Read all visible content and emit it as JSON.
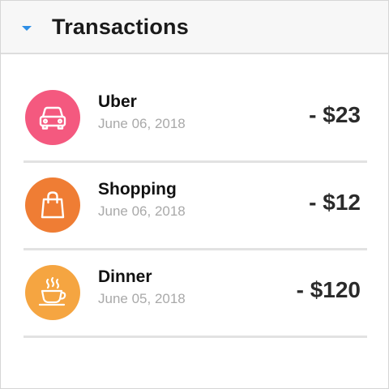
{
  "header": {
    "title": "Transactions"
  },
  "colors": {
    "uber": "#f4597f",
    "shopping": "#ef7d34",
    "dinner": "#f5a541"
  },
  "transactions": [
    {
      "name": "Uber",
      "date": "June 06, 2018",
      "amount": "- $23",
      "icon": "car-icon"
    },
    {
      "name": "Shopping",
      "date": "June 06, 2018",
      "amount": "- $12",
      "icon": "shopping-bag-icon"
    },
    {
      "name": "Dinner",
      "date": "June 05, 2018",
      "amount": "- $120",
      "icon": "coffee-cup-icon"
    }
  ]
}
